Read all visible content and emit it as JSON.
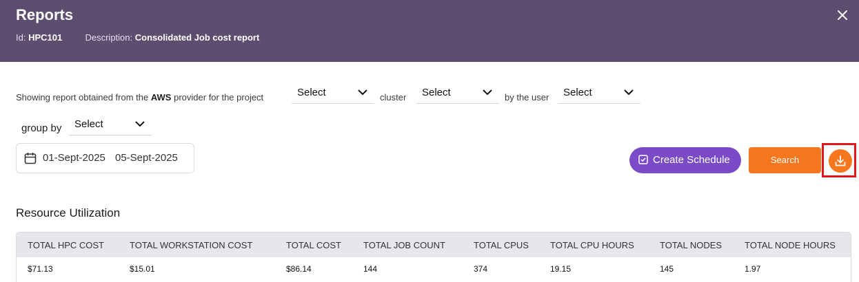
{
  "header": {
    "title": "Reports",
    "id_label": "Id:",
    "id_value": "HPC101",
    "description_label": "Description:",
    "description_value": "Consolidated Job cost report",
    "close_icon": "close-icon"
  },
  "filters": {
    "text_prefix": "Showing report obtained from the",
    "provider": "AWS",
    "text_provider_suffix": "provider for the project",
    "project_select": "Select",
    "text_cluster": "cluster",
    "cluster_select": "Select",
    "text_user": "by the user",
    "user_select": "Select",
    "text_group_by": "group by",
    "group_by_select": "Select"
  },
  "date_range": {
    "icon": "calendar-icon",
    "start": "01-Sept-2025",
    "end": "05-Sept-2025"
  },
  "actions": {
    "create_schedule": "Create Schedule",
    "search": "Search",
    "download_icon": "download-icon"
  },
  "colors": {
    "header_bg": "#5d4e70",
    "schedule_button": "#7b4bc7",
    "accent_orange": "#f7771f",
    "highlight_red": "#e0161d"
  },
  "resource_utilization": {
    "title": "Resource Utilization",
    "columns": [
      "TOTAL HPC COST",
      "TOTAL WORKSTATION COST",
      "TOTAL COST",
      "TOTAL JOB COUNT",
      "TOTAL CPUS",
      "TOTAL CPU HOURS",
      "TOTAL NODES",
      "TOTAL NODE HOURS"
    ],
    "rows": [
      [
        "$71.13",
        "$15.01",
        "$86.14",
        "144",
        "374",
        "19.15",
        "145",
        "1.97"
      ]
    ]
  }
}
